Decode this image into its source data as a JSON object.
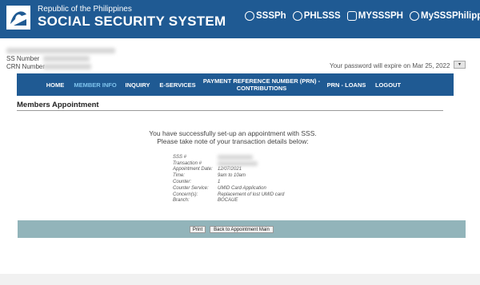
{
  "header": {
    "subtitle": "Republic of the Philippines",
    "title": "SOCIAL SECURITY SYSTEM",
    "socials": [
      {
        "icon": "facebook-icon",
        "label": "SSSPh"
      },
      {
        "icon": "twitter-icon",
        "label": "PHLSSS"
      },
      {
        "icon": "instagram-icon",
        "label": "MYSSSPH"
      },
      {
        "icon": "youtube-icon",
        "label": "MySSSPhilippines"
      }
    ]
  },
  "account": {
    "ss_number_label": "SS Number",
    "crn_number_label": "CRN Number",
    "password_notice": "Your password will expire on Mar 25, 2022"
  },
  "nav": {
    "items": [
      {
        "label": "HOME"
      },
      {
        "label": "MEMBER INFO"
      },
      {
        "label": "INQUIRY"
      },
      {
        "label": "E-SERVICES"
      },
      {
        "label": "PAYMENT REFERENCE NUMBER (PRN) - CONTRIBUTIONS"
      },
      {
        "label": "PRN - LOANS"
      },
      {
        "label": "LOGOUT"
      }
    ]
  },
  "main": {
    "title": "Members Appointment",
    "message_line1": "You have successfully set-up an appointment with SSS.",
    "message_line2": "Please take note of your transaction details below:",
    "details": [
      {
        "label": "SSS #",
        "value": ""
      },
      {
        "label": "Transaction #",
        "value": ""
      },
      {
        "label": "Appointment Date:",
        "value": "12/07/2021"
      },
      {
        "label": "Time:",
        "value": "9am to 10am"
      },
      {
        "label": "Counter:",
        "value": "1"
      },
      {
        "label": "Counter Service:",
        "value": "UMID Card Application"
      },
      {
        "label": "Concern(s):",
        "value": "Replacement of lost UMID card"
      },
      {
        "label": "Branch:",
        "value": "BOCAUE"
      }
    ],
    "print_label": "Print",
    "back_label": "Back to Appointment Main"
  },
  "colors": {
    "header_bg": "#1f5a93",
    "nav_active": "#7fc4ee",
    "action_bar": "#92b4ba"
  }
}
